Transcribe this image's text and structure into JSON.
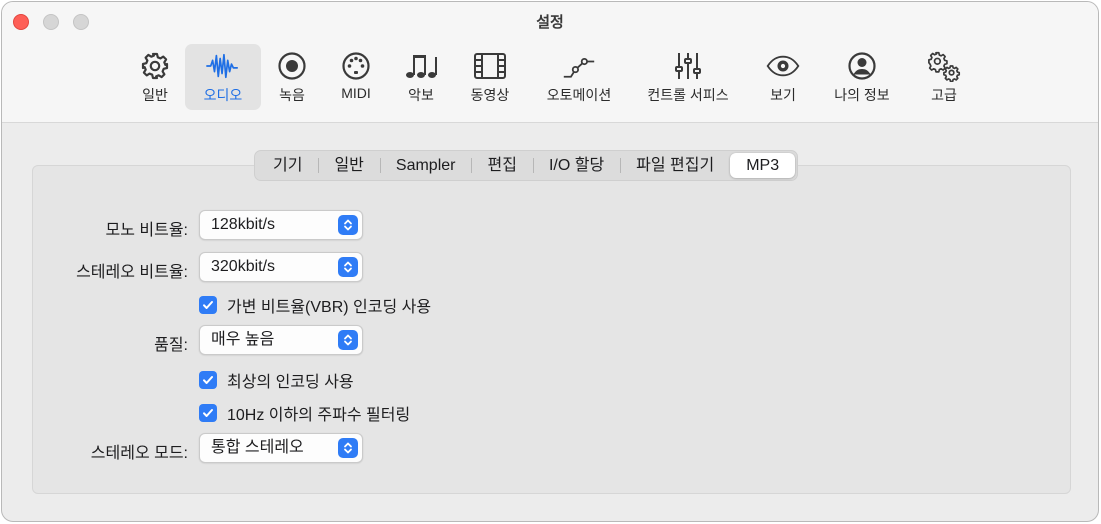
{
  "window": {
    "title": "설정"
  },
  "toolbar": {
    "items": [
      {
        "label": "일반",
        "icon": "gear-icon"
      },
      {
        "label": "오디오",
        "icon": "waveform-icon",
        "active": true
      },
      {
        "label": "녹음",
        "icon": "record-icon"
      },
      {
        "label": "MIDI",
        "icon": "midi-port-icon"
      },
      {
        "label": "악보",
        "icon": "music-notes-icon"
      },
      {
        "label": "동영상",
        "icon": "film-icon"
      },
      {
        "label": "오토메이션",
        "icon": "automation-curve-icon"
      },
      {
        "label": "컨트롤 서피스",
        "icon": "faders-icon"
      },
      {
        "label": "보기",
        "icon": "eye-icon"
      },
      {
        "label": "나의 정보",
        "icon": "person-icon"
      },
      {
        "label": "고급",
        "icon": "gears-icon"
      }
    ]
  },
  "tabs": [
    "기기",
    "일반",
    "Sampler",
    "편집",
    "I/O 할당",
    "파일 편집기",
    "MP3"
  ],
  "active_tab": "MP3",
  "form": {
    "mono_bitrate": {
      "label": "모노 비트율:",
      "value": "128kbit/s"
    },
    "stereo_bitrate": {
      "label": "스테레오 비트율:",
      "value": "320kbit/s"
    },
    "vbr": {
      "label": "가변 비트율(VBR) 인코딩 사용",
      "checked": true
    },
    "quality": {
      "label": "품질:",
      "value": "매우 높음"
    },
    "best_encoding": {
      "label": "최상의 인코딩 사용",
      "checked": true
    },
    "filter_10hz": {
      "label": "10Hz 이하의 주파수 필터링",
      "checked": true
    },
    "stereo_mode": {
      "label": "스테레오 모드:",
      "value": "통합 스테레오"
    }
  },
  "colors": {
    "accent": "#2f7cf6",
    "active_label": "#1f6fe5",
    "close": "#fe5f57"
  }
}
